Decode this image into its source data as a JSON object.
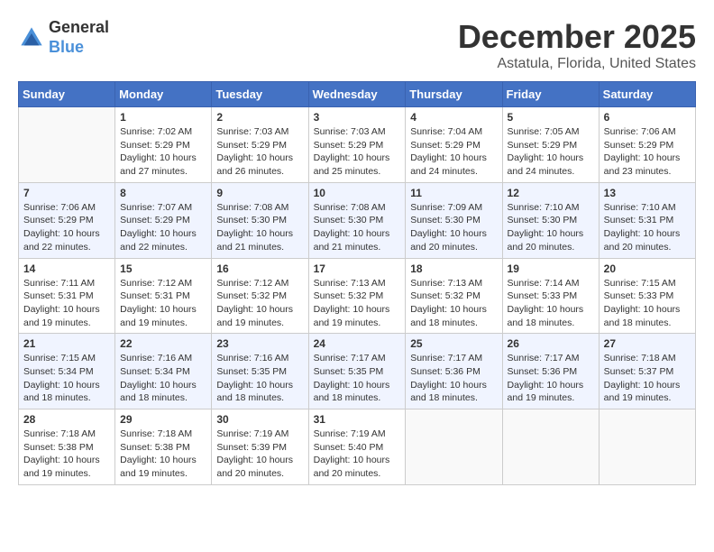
{
  "app": {
    "name_general": "General",
    "name_blue": "Blue"
  },
  "header": {
    "month": "December 2025",
    "location": "Astatula, Florida, United States"
  },
  "days_of_week": [
    "Sunday",
    "Monday",
    "Tuesday",
    "Wednesday",
    "Thursday",
    "Friday",
    "Saturday"
  ],
  "weeks": [
    [
      {
        "day": "",
        "empty": true
      },
      {
        "day": "1",
        "sunrise": "Sunrise: 7:02 AM",
        "sunset": "Sunset: 5:29 PM",
        "daylight": "Daylight: 10 hours and 27 minutes."
      },
      {
        "day": "2",
        "sunrise": "Sunrise: 7:03 AM",
        "sunset": "Sunset: 5:29 PM",
        "daylight": "Daylight: 10 hours and 26 minutes."
      },
      {
        "day": "3",
        "sunrise": "Sunrise: 7:03 AM",
        "sunset": "Sunset: 5:29 PM",
        "daylight": "Daylight: 10 hours and 25 minutes."
      },
      {
        "day": "4",
        "sunrise": "Sunrise: 7:04 AM",
        "sunset": "Sunset: 5:29 PM",
        "daylight": "Daylight: 10 hours and 24 minutes."
      },
      {
        "day": "5",
        "sunrise": "Sunrise: 7:05 AM",
        "sunset": "Sunset: 5:29 PM",
        "daylight": "Daylight: 10 hours and 24 minutes."
      },
      {
        "day": "6",
        "sunrise": "Sunrise: 7:06 AM",
        "sunset": "Sunset: 5:29 PM",
        "daylight": "Daylight: 10 hours and 23 minutes."
      }
    ],
    [
      {
        "day": "7",
        "sunrise": "Sunrise: 7:06 AM",
        "sunset": "Sunset: 5:29 PM",
        "daylight": "Daylight: 10 hours and 22 minutes."
      },
      {
        "day": "8",
        "sunrise": "Sunrise: 7:07 AM",
        "sunset": "Sunset: 5:29 PM",
        "daylight": "Daylight: 10 hours and 22 minutes."
      },
      {
        "day": "9",
        "sunrise": "Sunrise: 7:08 AM",
        "sunset": "Sunset: 5:30 PM",
        "daylight": "Daylight: 10 hours and 21 minutes."
      },
      {
        "day": "10",
        "sunrise": "Sunrise: 7:08 AM",
        "sunset": "Sunset: 5:30 PM",
        "daylight": "Daylight: 10 hours and 21 minutes."
      },
      {
        "day": "11",
        "sunrise": "Sunrise: 7:09 AM",
        "sunset": "Sunset: 5:30 PM",
        "daylight": "Daylight: 10 hours and 20 minutes."
      },
      {
        "day": "12",
        "sunrise": "Sunrise: 7:10 AM",
        "sunset": "Sunset: 5:30 PM",
        "daylight": "Daylight: 10 hours and 20 minutes."
      },
      {
        "day": "13",
        "sunrise": "Sunrise: 7:10 AM",
        "sunset": "Sunset: 5:31 PM",
        "daylight": "Daylight: 10 hours and 20 minutes."
      }
    ],
    [
      {
        "day": "14",
        "sunrise": "Sunrise: 7:11 AM",
        "sunset": "Sunset: 5:31 PM",
        "daylight": "Daylight: 10 hours and 19 minutes."
      },
      {
        "day": "15",
        "sunrise": "Sunrise: 7:12 AM",
        "sunset": "Sunset: 5:31 PM",
        "daylight": "Daylight: 10 hours and 19 minutes."
      },
      {
        "day": "16",
        "sunrise": "Sunrise: 7:12 AM",
        "sunset": "Sunset: 5:32 PM",
        "daylight": "Daylight: 10 hours and 19 minutes."
      },
      {
        "day": "17",
        "sunrise": "Sunrise: 7:13 AM",
        "sunset": "Sunset: 5:32 PM",
        "daylight": "Daylight: 10 hours and 19 minutes."
      },
      {
        "day": "18",
        "sunrise": "Sunrise: 7:13 AM",
        "sunset": "Sunset: 5:32 PM",
        "daylight": "Daylight: 10 hours and 18 minutes."
      },
      {
        "day": "19",
        "sunrise": "Sunrise: 7:14 AM",
        "sunset": "Sunset: 5:33 PM",
        "daylight": "Daylight: 10 hours and 18 minutes."
      },
      {
        "day": "20",
        "sunrise": "Sunrise: 7:15 AM",
        "sunset": "Sunset: 5:33 PM",
        "daylight": "Daylight: 10 hours and 18 minutes."
      }
    ],
    [
      {
        "day": "21",
        "sunrise": "Sunrise: 7:15 AM",
        "sunset": "Sunset: 5:34 PM",
        "daylight": "Daylight: 10 hours and 18 minutes."
      },
      {
        "day": "22",
        "sunrise": "Sunrise: 7:16 AM",
        "sunset": "Sunset: 5:34 PM",
        "daylight": "Daylight: 10 hours and 18 minutes."
      },
      {
        "day": "23",
        "sunrise": "Sunrise: 7:16 AM",
        "sunset": "Sunset: 5:35 PM",
        "daylight": "Daylight: 10 hours and 18 minutes."
      },
      {
        "day": "24",
        "sunrise": "Sunrise: 7:17 AM",
        "sunset": "Sunset: 5:35 PM",
        "daylight": "Daylight: 10 hours and 18 minutes."
      },
      {
        "day": "25",
        "sunrise": "Sunrise: 7:17 AM",
        "sunset": "Sunset: 5:36 PM",
        "daylight": "Daylight: 10 hours and 18 minutes."
      },
      {
        "day": "26",
        "sunrise": "Sunrise: 7:17 AM",
        "sunset": "Sunset: 5:36 PM",
        "daylight": "Daylight: 10 hours and 19 minutes."
      },
      {
        "day": "27",
        "sunrise": "Sunrise: 7:18 AM",
        "sunset": "Sunset: 5:37 PM",
        "daylight": "Daylight: 10 hours and 19 minutes."
      }
    ],
    [
      {
        "day": "28",
        "sunrise": "Sunrise: 7:18 AM",
        "sunset": "Sunset: 5:38 PM",
        "daylight": "Daylight: 10 hours and 19 minutes."
      },
      {
        "day": "29",
        "sunrise": "Sunrise: 7:18 AM",
        "sunset": "Sunset: 5:38 PM",
        "daylight": "Daylight: 10 hours and 19 minutes."
      },
      {
        "day": "30",
        "sunrise": "Sunrise: 7:19 AM",
        "sunset": "Sunset: 5:39 PM",
        "daylight": "Daylight: 10 hours and 20 minutes."
      },
      {
        "day": "31",
        "sunrise": "Sunrise: 7:19 AM",
        "sunset": "Sunset: 5:40 PM",
        "daylight": "Daylight: 10 hours and 20 minutes."
      },
      {
        "day": "",
        "empty": true
      },
      {
        "day": "",
        "empty": true
      },
      {
        "day": "",
        "empty": true
      }
    ]
  ]
}
